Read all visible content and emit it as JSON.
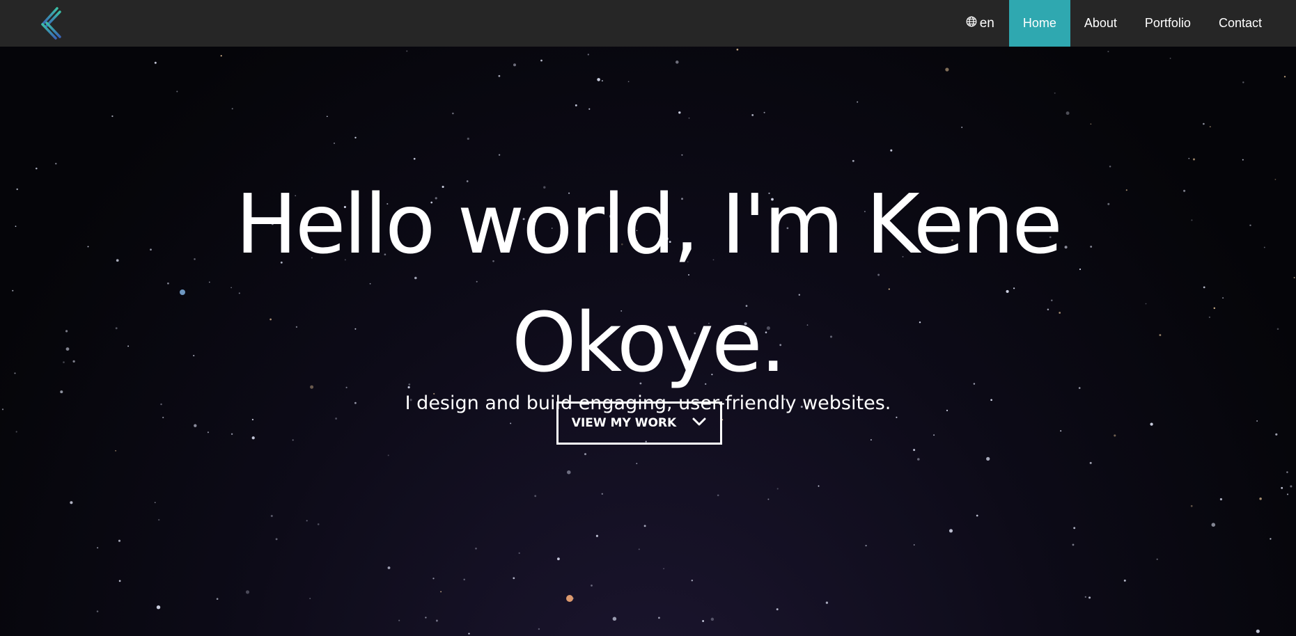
{
  "navbar": {
    "logo_icon": "k-monogram-logo",
    "language": {
      "icon": "globe-icon",
      "label": "en"
    },
    "links": [
      {
        "label": "Home",
        "active": true
      },
      {
        "label": "About",
        "active": false
      },
      {
        "label": "Portfolio",
        "active": false
      },
      {
        "label": "Contact",
        "active": false
      }
    ],
    "colors": {
      "background": "#262626",
      "active": "#2fa8b0",
      "text": "#ffffff"
    }
  },
  "hero": {
    "title_line1": "Hello world, I'm Kene",
    "title_line2": "Okoye.",
    "subtitle": "I design and build engaging, user-friendly websites.",
    "cta_label": "VIEW MY WORK",
    "cta_icon": "chevron-down-icon",
    "background": "night-sky-starfield"
  }
}
